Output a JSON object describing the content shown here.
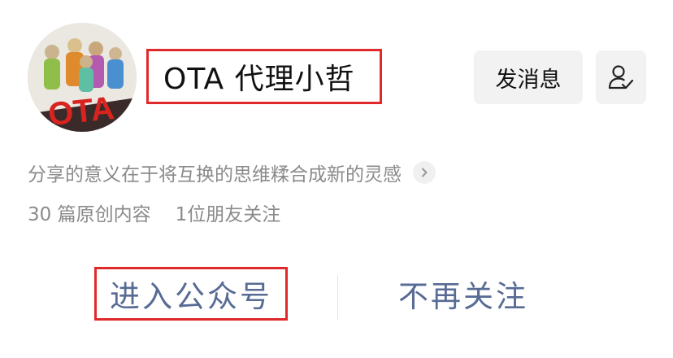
{
  "profile": {
    "name": "OTA 代理小哲",
    "avatar_text": "OTA",
    "bio": "分享的意义在于将互换的思维糅合成新的灵感",
    "stats": {
      "original_count": "30 篇原创内容",
      "friends_following": "1位朋友关注"
    }
  },
  "actions": {
    "message_label": "发消息",
    "enter_label": "进入公众号",
    "unfollow_label": "不再关注"
  },
  "icons": {
    "user_settings": "user-check-icon",
    "bio_more": "chevron-right-icon"
  },
  "colors": {
    "link_blue": "#576b95",
    "highlight_red": "#e0292b",
    "secondary_text": "#8a8a8a",
    "button_bg": "#f2f2f2"
  }
}
